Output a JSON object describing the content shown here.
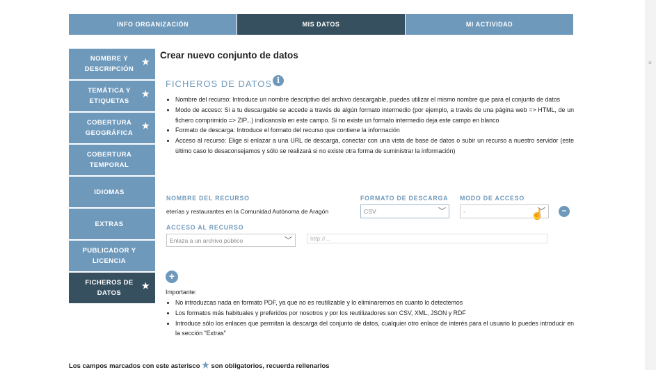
{
  "topnav": {
    "tabs": [
      {
        "label": "INFO ORGANIZACIÓN"
      },
      {
        "label": "MIS DATOS"
      },
      {
        "label": "MI ACTIVIDAD"
      }
    ]
  },
  "sidebar": {
    "items": [
      {
        "label_l1": "NOMBRE Y",
        "label_l2": "DESCRIPCIÓN",
        "required": "★"
      },
      {
        "label_l1": "TEMÁTICA Y",
        "label_l2": "ETIQUETAS",
        "required": "★"
      },
      {
        "label_l1": "COBERTURA",
        "label_l2": "GEOGRÁFICA",
        "required": "★"
      },
      {
        "label_l1": "COBERTURA",
        "label_l2": "TEMPORAL"
      },
      {
        "label_l1": "IDIOMAS",
        "label_l2": ""
      },
      {
        "label_l1": "EXTRAS",
        "label_l2": ""
      },
      {
        "label_l1": "PUBLICADOR Y",
        "label_l2": "LICENCIA"
      },
      {
        "label_l1": "FICHEROS DE",
        "label_l2": "DATOS",
        "required": "★"
      }
    ]
  },
  "main": {
    "title": "Crear nuevo conjunto de datos",
    "section_title": "FICHEROS DE DATOS",
    "section_star": "*",
    "info_icon": "i",
    "bullets": [
      "Nombre del recurso: Introduce un nombre descriptivo del archivo descargable, puedes utilizar el mismo nombre que para el conjunto de datos",
      "Modo de acceso: Si a tu descargable se accede a través de algún formato intermedio (por ejemplo, a través de una página web => HTML, de un fichero comprimido => ZIP...) indícanoslo en este campo. Si no existe un formato intermedio deja este campo en blanco",
      "Formato de descarga: Introduce el formato del recurso que contiene la información",
      "Acceso al recurso: Elige si enlazar a una URL de descarga, conectar con una vista de base de datos o subir un recurso a nuestro servidor (este último caso lo desaconsejamos y sólo se realizará si no existe otra forma de suministrar la información)"
    ],
    "labels": {
      "nombre": "NOMBRE DEL RECURSO",
      "formato": "FORMATO DE DESCARGA",
      "modo": "MODO DE ACCESO",
      "acceso": "ACCESO AL RECURSO"
    },
    "fields": {
      "nombre_value": "eterías y restaurantes en la Comunidad Autónoma de Aragón",
      "formato_value": "CSV",
      "modo_value": "-",
      "acceso_value": "Enlaza a un archivo público",
      "url_placeholder": "http://..."
    },
    "remove_label": "−",
    "add_label": "+",
    "important_title": "Importante:",
    "important_bullets": [
      "No introduzcas nada en formato PDF, ya que no es reutilizable y lo eliminaremos en cuanto lo detectemos",
      "Los formatos más habituales y preferidos por nosotros y por los reutilizadores son CSV, XML, JSON y RDF",
      "Introduce sólo los enlaces que permitan la descarga del conjunto de datos, cualquier otro enlace de interés para el usuario lo puedes introducir en la sección \"Extras\""
    ]
  },
  "footer": {
    "text_before": "Los campos marcados con este asterisco ",
    "star": "★",
    "text_after": " son obligatorios, recuerda rellenarlos"
  },
  "colors": {
    "accent": "#6f99bb",
    "active": "#37505f"
  }
}
